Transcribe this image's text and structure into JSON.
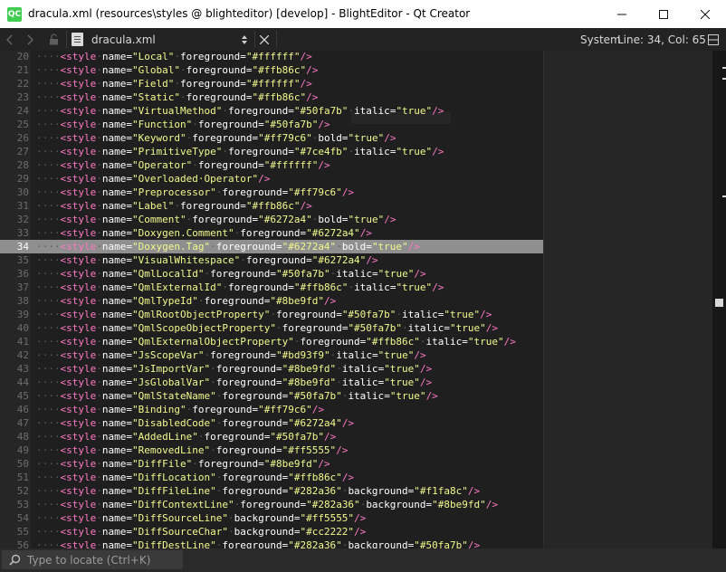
{
  "titlebar": {
    "app_icon_text": "QC",
    "title": "dracula.xml (resources\\styles @ blighteditor) [develop] - BlightEditor - Qt Creator",
    "minimize_icon": "minimize-icon",
    "maximize_icon": "maximize-icon",
    "close_icon": "close-icon"
  },
  "toolbar": {
    "file_name": "dracula.xml",
    "encoding": "System",
    "position": "Line: 34, Col: 65"
  },
  "editor": {
    "current_line": 34,
    "lines": [
      {
        "num": "20",
        "name": "Local",
        "attrs": [
          [
            "foreground",
            "#ffffff"
          ]
        ]
      },
      {
        "num": "21",
        "name": "Global",
        "attrs": [
          [
            "foreground",
            "#ffb86c"
          ]
        ]
      },
      {
        "num": "22",
        "name": "Field",
        "attrs": [
          [
            "foreground",
            "#ffffff"
          ]
        ]
      },
      {
        "num": "23",
        "name": "Static",
        "attrs": [
          [
            "foreground",
            "#ffb86c"
          ]
        ]
      },
      {
        "num": "24",
        "name": "VirtualMethod",
        "attrs": [
          [
            "foreground",
            "#50fa7b"
          ],
          [
            "italic",
            "true"
          ]
        ]
      },
      {
        "num": "25",
        "name": "Function",
        "attrs": [
          [
            "foreground",
            "#50fa7b"
          ]
        ]
      },
      {
        "num": "26",
        "name": "Keyword",
        "attrs": [
          [
            "foreground",
            "#ff79c6"
          ],
          [
            "bold",
            "true"
          ]
        ]
      },
      {
        "num": "27",
        "name": "PrimitiveType",
        "attrs": [
          [
            "foreground",
            "#7ce4fb"
          ],
          [
            "italic",
            "true"
          ]
        ]
      },
      {
        "num": "28",
        "name": "Operator",
        "attrs": [
          [
            "foreground",
            "#ffffff"
          ]
        ]
      },
      {
        "num": "29",
        "name": "Overloaded Operator",
        "attrs": []
      },
      {
        "num": "30",
        "name": "Preprocessor",
        "attrs": [
          [
            "foreground",
            "#ff79c6"
          ]
        ]
      },
      {
        "num": "31",
        "name": "Label",
        "attrs": [
          [
            "foreground",
            "#ffb86c"
          ]
        ]
      },
      {
        "num": "32",
        "name": "Comment",
        "attrs": [
          [
            "foreground",
            "#6272a4"
          ],
          [
            "bold",
            "true"
          ]
        ]
      },
      {
        "num": "33",
        "name": "Doxygen.Comment",
        "attrs": [
          [
            "foreground",
            "#6272a4"
          ]
        ]
      },
      {
        "num": "34",
        "name": "Doxygen.Tag",
        "attrs": [
          [
            "foreground",
            "#6272a4"
          ],
          [
            "bold",
            "true"
          ]
        ]
      },
      {
        "num": "35",
        "name": "VisualWhitespace",
        "attrs": [
          [
            "foreground",
            "#6272a4"
          ]
        ]
      },
      {
        "num": "36",
        "name": "QmlLocalId",
        "attrs": [
          [
            "foreground",
            "#50fa7b"
          ],
          [
            "italic",
            "true"
          ]
        ]
      },
      {
        "num": "37",
        "name": "QmlExternalId",
        "attrs": [
          [
            "foreground",
            "#ffb86c"
          ],
          [
            "italic",
            "true"
          ]
        ]
      },
      {
        "num": "38",
        "name": "QmlTypeId",
        "attrs": [
          [
            "foreground",
            "#8be9fd"
          ]
        ]
      },
      {
        "num": "39",
        "name": "QmlRootObjectProperty",
        "attrs": [
          [
            "foreground",
            "#50fa7b"
          ],
          [
            "italic",
            "true"
          ]
        ]
      },
      {
        "num": "40",
        "name": "QmlScopeObjectProperty",
        "attrs": [
          [
            "foreground",
            "#50fa7b"
          ],
          [
            "italic",
            "true"
          ]
        ]
      },
      {
        "num": "41",
        "name": "QmlExternalObjectProperty",
        "attrs": [
          [
            "foreground",
            "#ffb86c"
          ],
          [
            "italic",
            "true"
          ]
        ]
      },
      {
        "num": "42",
        "name": "JsScopeVar",
        "attrs": [
          [
            "foreground",
            "#bd93f9"
          ],
          [
            "italic",
            "true"
          ]
        ]
      },
      {
        "num": "43",
        "name": "JsImportVar",
        "attrs": [
          [
            "foreground",
            "#8be9fd"
          ],
          [
            "italic",
            "true"
          ]
        ]
      },
      {
        "num": "44",
        "name": "JsGlobalVar",
        "attrs": [
          [
            "foreground",
            "#8be9fd"
          ],
          [
            "italic",
            "true"
          ]
        ]
      },
      {
        "num": "45",
        "name": "QmlStateName",
        "attrs": [
          [
            "foreground",
            "#50fa7b"
          ],
          [
            "italic",
            "true"
          ]
        ]
      },
      {
        "num": "46",
        "name": "Binding",
        "attrs": [
          [
            "foreground",
            "#ff79c6"
          ]
        ]
      },
      {
        "num": "47",
        "name": "DisabledCode",
        "attrs": [
          [
            "foreground",
            "#6272a4"
          ]
        ]
      },
      {
        "num": "48",
        "name": "AddedLine",
        "attrs": [
          [
            "foreground",
            "#50fa7b"
          ]
        ]
      },
      {
        "num": "49",
        "name": "RemovedLine",
        "attrs": [
          [
            "foreground",
            "#ff5555"
          ]
        ]
      },
      {
        "num": "50",
        "name": "DiffFile",
        "attrs": [
          [
            "foreground",
            "#8be9fd"
          ]
        ]
      },
      {
        "num": "51",
        "name": "DiffLocation",
        "attrs": [
          [
            "foreground",
            "#ffb86c"
          ]
        ]
      },
      {
        "num": "52",
        "name": "DiffFileLine",
        "attrs": [
          [
            "foreground",
            "#282a36"
          ],
          [
            "background",
            "#f1fa8c"
          ]
        ]
      },
      {
        "num": "53",
        "name": "DiffContextLine",
        "attrs": [
          [
            "foreground",
            "#282a36"
          ],
          [
            "background",
            "#8be9fd"
          ]
        ]
      },
      {
        "num": "54",
        "name": "DiffSourceLine",
        "attrs": [
          [
            "background",
            "#ff5555"
          ]
        ]
      },
      {
        "num": "55",
        "name": "DiffSourceChar",
        "attrs": [
          [
            "background",
            "#cc2222"
          ]
        ]
      },
      {
        "num": "56",
        "name": "DiffDestLine",
        "attrs": [
          [
            "foreground",
            "#282a36"
          ],
          [
            "background",
            "#50fa7b"
          ]
        ]
      }
    ]
  },
  "locator": {
    "placeholder": "Type to locate (Ctrl+K)"
  },
  "colors": {
    "tag": "#ff79c6",
    "value": "#f1fa8c",
    "attribute": "#ffffff",
    "editor_bg": "#1f1f1f",
    "current_line_bg": "#8f8f8f",
    "qt_green": "#41cd52"
  }
}
